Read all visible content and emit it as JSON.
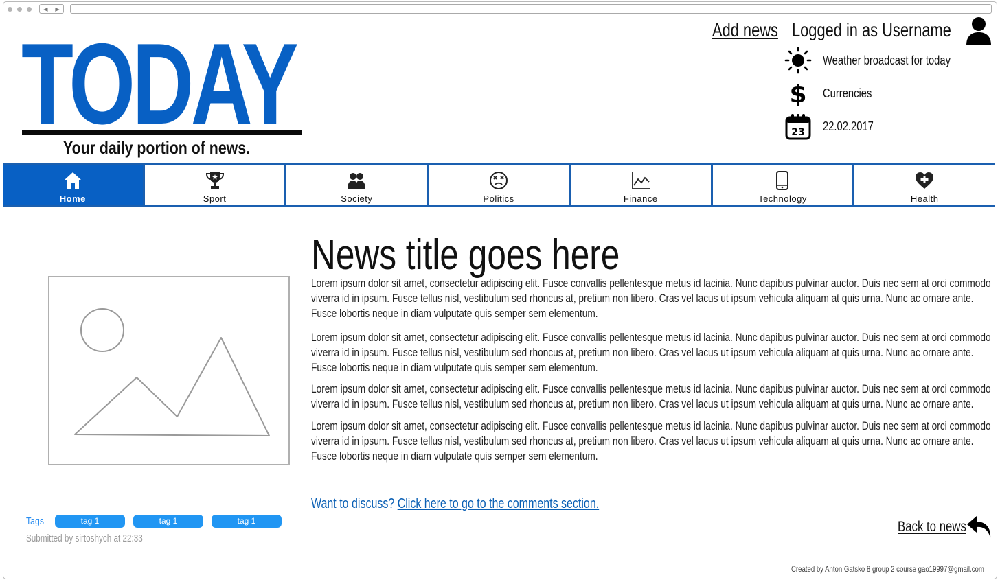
{
  "header": {
    "logo_text": "TODAY",
    "tagline": "Your daily portion of news.",
    "add_news": "Add news",
    "logged_in": "Logged in as Username",
    "weather": "Weather broadcast for today",
    "currencies": "Currencies",
    "date": "22.02.2017",
    "calendar_day": "23"
  },
  "nav": {
    "items": [
      {
        "label": "Home",
        "icon": "home-icon",
        "active": true
      },
      {
        "label": "Sport",
        "icon": "trophy-icon"
      },
      {
        "label": "Society",
        "icon": "people-icon"
      },
      {
        "label": "Politics",
        "icon": "dizzy-face-icon"
      },
      {
        "label": "Finance",
        "icon": "chart-icon"
      },
      {
        "label": "Technology",
        "icon": "phone-icon"
      },
      {
        "label": "Health",
        "icon": "heart-plus-icon"
      }
    ]
  },
  "article": {
    "title": "News title goes here",
    "paragraphs": [
      "Lorem ipsum dolor sit amet, consectetur adipiscing elit. Fusce convallis pellentesque metus id lacinia. Nunc dapibus pulvinar auctor. Duis nec sem at orci commodo viverra id in ipsum. Fusce tellus nisl, vestibulum sed rhoncus at, pretium non libero. Cras vel lacus ut ipsum vehicula aliquam at quis urna. Nunc ac ornare ante. Fusce lobortis neque in diam vulputate quis semper sem elementum.",
      "Lorem ipsum dolor sit amet, consectetur adipiscing elit. Fusce convallis pellentesque metus id lacinia. Nunc dapibus pulvinar auctor. Duis nec sem at orci commodo viverra id in ipsum. Fusce tellus nisl, vestibulum sed rhoncus at, pretium non libero. Cras vel lacus ut ipsum vehicula aliquam at quis urna. Nunc ac ornare ante. Fusce lobortis neque in diam vulputate quis semper sem elementum.",
      "Lorem ipsum dolor sit amet, consectetur adipiscing elit. Fusce convallis pellentesque metus id lacinia. Nunc dapibus pulvinar auctor. Duis nec sem at orci commodo viverra id in ipsum. Fusce tellus nisl, vestibulum sed rhoncus at, pretium non libero. Cras vel lacus ut ipsum vehicula aliquam at quis urna. Nunc ac ornare ante.",
      "Lorem ipsum dolor sit amet, consectetur adipiscing elit. Fusce convallis pellentesque metus id lacinia. Nunc dapibus pulvinar auctor. Duis nec sem at orci commodo viverra id in ipsum. Fusce tellus nisl, vestibulum sed rhoncus at, pretium non libero. Cras vel lacus ut ipsum vehicula aliquam at quis urna. Nunc ac ornare ante.  Fusce lobortis neque in diam vulputate quis semper sem elementum."
    ],
    "discuss_prefix": "Want to discuss?",
    "discuss_link": "Click here to go to the comments section."
  },
  "meta": {
    "tags_label": "Tags",
    "tags": [
      "tag 1",
      "tag 1",
      "tag 1"
    ],
    "submitted": "Submitted by sirtoshych at 22:33"
  },
  "back_to_news": "Back to news",
  "footer": "Created by Anton Gatsko 8 group 2 course gao19997@gmail.com",
  "colors": {
    "brand_blue": "#0860c4",
    "nav_border": "#1a5fb0",
    "tag_blue": "#2196f3",
    "link_blue": "#0a5fb4"
  }
}
